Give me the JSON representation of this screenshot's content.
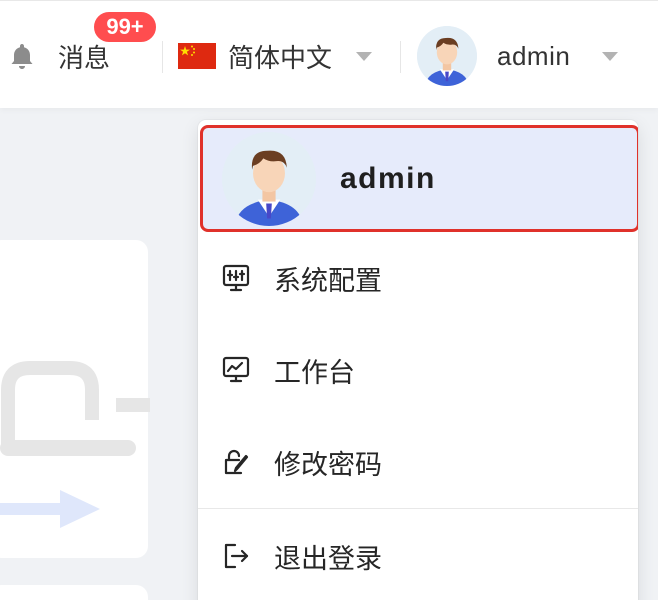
{
  "header": {
    "notifications": {
      "label": "消息",
      "badge": "99+",
      "icon": "bell-icon"
    },
    "language": {
      "label": "简体中文",
      "flag": "china-flag-icon",
      "icon": "caret-down-icon"
    },
    "user": {
      "name": "admin",
      "avatar": "user-avatar"
    }
  },
  "dropdown": {
    "profile": {
      "name": "admin"
    },
    "items": [
      {
        "label": "系统配置",
        "icon": "system-config-icon"
      },
      {
        "label": "工作台",
        "icon": "workbench-monitor-icon"
      },
      {
        "label": "修改密码",
        "icon": "edit-password-icon"
      },
      {
        "label": "退出登录",
        "icon": "logout-icon"
      }
    ]
  },
  "colors": {
    "badge": "#ff4d4f",
    "highlight_border": "#e0312b",
    "highlight_bg": "#e6ebfb",
    "page_bg": "#f0f2f5"
  }
}
